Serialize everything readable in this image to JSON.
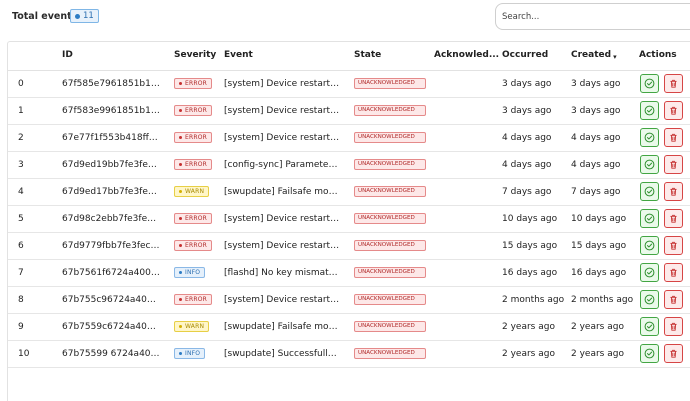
{
  "header": {
    "total_label": "Total events",
    "total_count": "11",
    "search_placeholder": "Search..."
  },
  "columns": {
    "id": "ID",
    "severity": "Severity",
    "event": "Event",
    "state": "State",
    "acknowledged": "Acknowled...",
    "occurred": "Occurred",
    "created": "Created",
    "actions": "Actions"
  },
  "rows": [
    {
      "index": "0",
      "id": "67f585e7961851b1a058...",
      "severity": "ERROR",
      "sev_class": "error",
      "event": "[system] Device restarted ...",
      "state": "UNACKNOWLEDGED",
      "acknowledged": "",
      "occurred": "3 days ago",
      "created": "3 days ago"
    },
    {
      "index": "1",
      "id": "67f583e9961851b1a058...",
      "severity": "ERROR",
      "sev_class": "error",
      "event": "[system] Device restarted ...",
      "state": "UNACKNOWLEDGED",
      "acknowledged": "",
      "occurred": "3 days ago",
      "created": "3 days ago"
    },
    {
      "index": "2",
      "id": "67e77f1f553b418ff8d3d...",
      "severity": "ERROR",
      "sev_class": "error",
      "event": "[system] Device restarted ...",
      "state": "UNACKNOWLEDGED",
      "acknowledged": "",
      "occurred": "4 days ago",
      "created": "4 days ago"
    },
    {
      "index": "3",
      "id": "67d9ed19bb7fe3fec749...",
      "severity": "ERROR",
      "sev_class": "error",
      "event": "[config-sync] Parameters ...",
      "state": "UNACKNOWLEDGED",
      "acknowledged": "",
      "occurred": "4 days ago",
      "created": "4 days ago"
    },
    {
      "index": "4",
      "id": "67d9ed17bb7fe3fec749...",
      "severity": "WARN",
      "sev_class": "warn",
      "event": "[swupdate] Failsafe mode ...",
      "state": "UNACKNOWLEDGED",
      "acknowledged": "",
      "occurred": "7 days ago",
      "created": "7 days ago"
    },
    {
      "index": "5",
      "id": "67d98c2ebb7fe3fec740...",
      "severity": "ERROR",
      "sev_class": "error",
      "event": "[system] Device restarted ...",
      "state": "UNACKNOWLEDGED",
      "acknowledged": "",
      "occurred": "10 days ago",
      "created": "10 days ago"
    },
    {
      "index": "6",
      "id": "67d9779fbb7fe3fec73e...",
      "severity": "ERROR",
      "sev_class": "error",
      "event": "[system] Device restarted ...",
      "state": "UNACKNOWLEDGED",
      "acknowledged": "",
      "occurred": "15 days ago",
      "created": "15 days ago"
    },
    {
      "index": "7",
      "id": "67b7561f6724a4009a0...",
      "severity": "INFO",
      "sev_class": "info",
      "event": "[flashd] No key mismatch ...",
      "state": "UNACKNOWLEDGED",
      "acknowledged": "",
      "occurred": "16 days ago",
      "created": "16 days ago"
    },
    {
      "index": "8",
      "id": "67b755c96724a4009a0...",
      "severity": "ERROR",
      "sev_class": "error",
      "event": "[system] Device restarted ...",
      "state": "UNACKNOWLEDGED",
      "acknowledged": "",
      "occurred": "2 months ago",
      "created": "2 months ago"
    },
    {
      "index": "9",
      "id": "67b7559c6724a4009a0...",
      "severity": "WARN",
      "sev_class": "warn",
      "event": "[swupdate] Failsafe mode ...",
      "state": "UNACKNOWLEDGED",
      "acknowledged": "",
      "occurred": "2 years ago",
      "created": "2 years ago"
    },
    {
      "index": "10",
      "id": "67b75599 6724a4009a0...",
      "severity": "INFO",
      "sev_class": "info",
      "event": "[swupdate] Successfully u...",
      "state": "UNACKNOWLEDGED",
      "acknowledged": "",
      "occurred": "2 years ago",
      "created": "2 years ago"
    }
  ],
  "icons": {
    "acknowledge": "check-circle-icon",
    "delete": "trash-icon",
    "sort": "sort-desc-icon"
  },
  "colors": {
    "error": "#c53030",
    "warn": "#d4b000",
    "info": "#2d7cc4",
    "acknowledge": "#43a543",
    "delete": "#d64545"
  }
}
